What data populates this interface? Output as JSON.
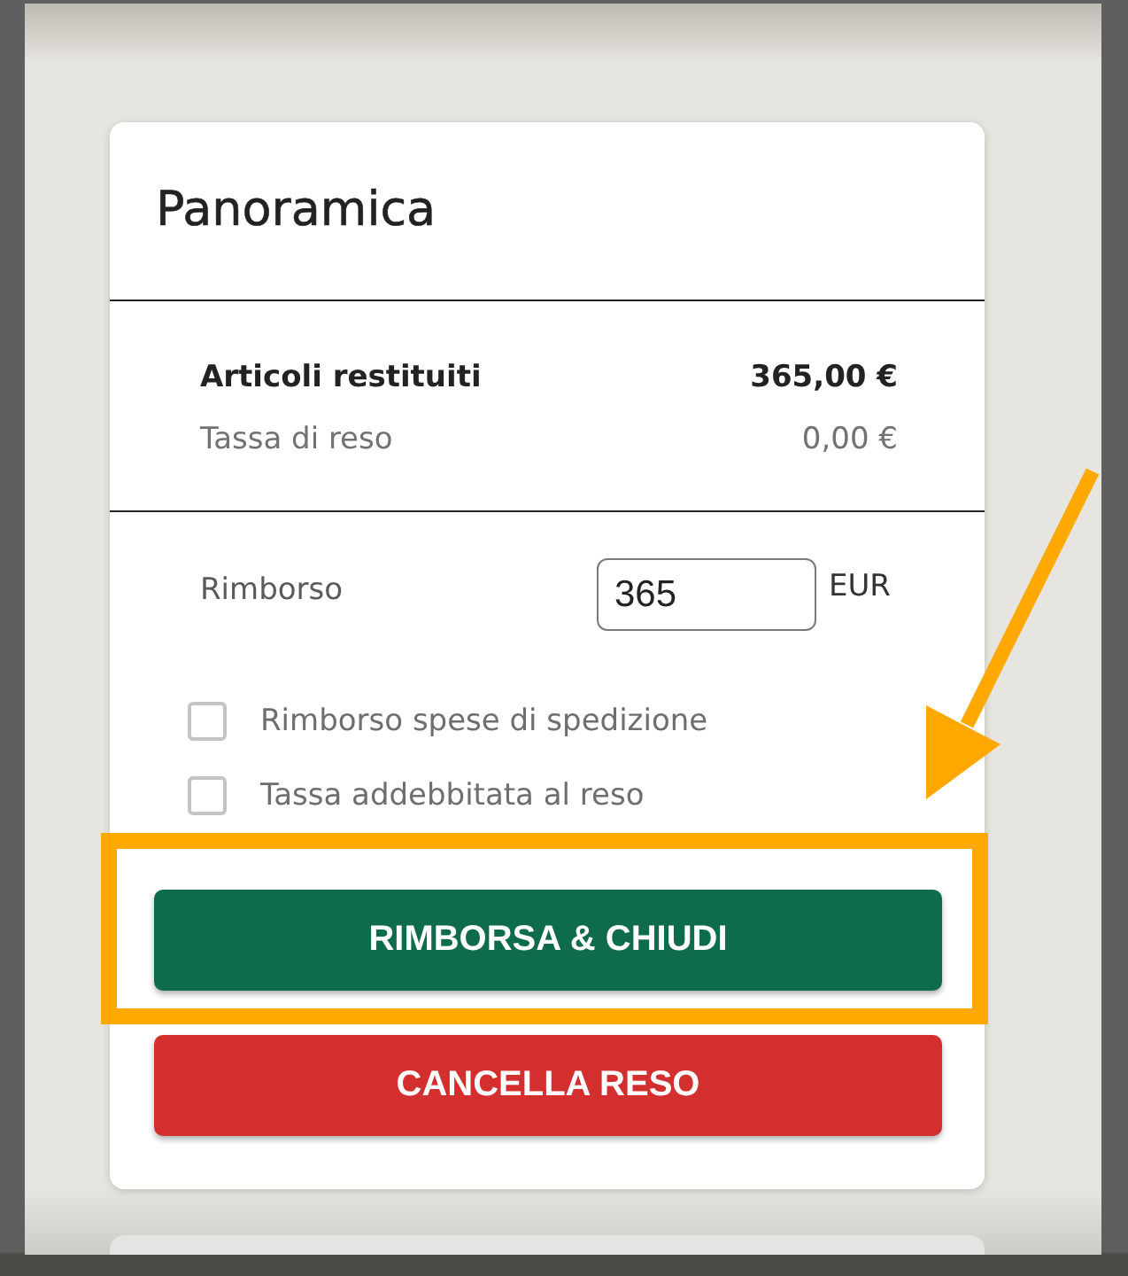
{
  "card": {
    "title": "Panoramica",
    "summary": [
      {
        "kind": "total",
        "label": "Articoli restituiti",
        "value": "365,00 €"
      },
      {
        "kind": "fee",
        "label": "Tassa di reso",
        "value": "0,00 €"
      }
    ],
    "refund": {
      "label": "Rimborso",
      "value": "365",
      "currency": "EUR"
    },
    "options": [
      {
        "label": "Rimborso spese di spedizione",
        "checked": false
      },
      {
        "label": "Tassa addebbitata al reso",
        "checked": false
      }
    ],
    "buttons": [
      {
        "kind": "primary",
        "label": "RIMBORSA & CHIUDI",
        "highlighted": true
      },
      {
        "kind": "danger",
        "label": "CANCELLA RESO",
        "highlighted": false
      }
    ]
  }
}
